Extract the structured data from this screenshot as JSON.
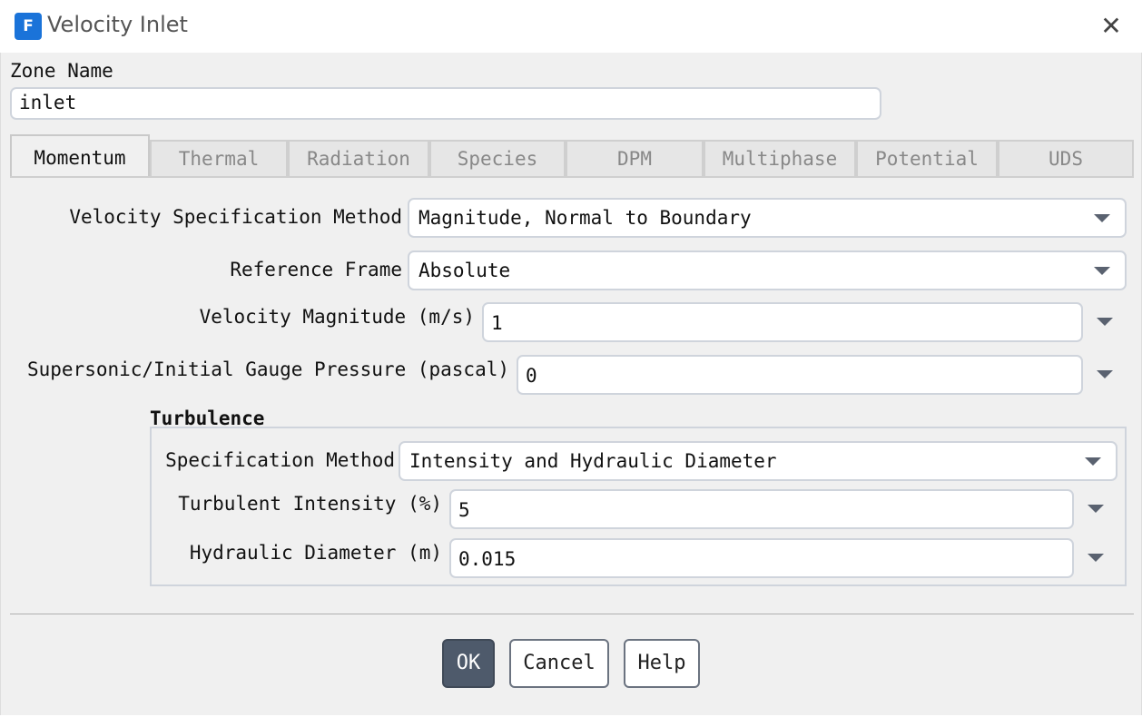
{
  "window": {
    "title": "Velocity Inlet",
    "app_icon_letter": "F",
    "close_glyph": "✕"
  },
  "zone": {
    "label": "Zone Name",
    "value": "inlet"
  },
  "tabs": [
    {
      "label": "Momentum",
      "active": true
    },
    {
      "label": "Thermal",
      "active": false
    },
    {
      "label": "Radiation",
      "active": false
    },
    {
      "label": "Species",
      "active": false
    },
    {
      "label": "DPM",
      "active": false
    },
    {
      "label": "Multiphase",
      "active": false
    },
    {
      "label": "Potential",
      "active": false
    },
    {
      "label": "UDS",
      "active": false
    }
  ],
  "momentum": {
    "velocity_spec": {
      "label": "Velocity Specification Method",
      "value": "Magnitude, Normal to Boundary"
    },
    "reference_frame": {
      "label": "Reference Frame",
      "value": "Absolute"
    },
    "velocity_magnitude": {
      "label": "Velocity Magnitude (m/s)",
      "value": "1"
    },
    "gauge_pressure": {
      "label": "Supersonic/Initial Gauge Pressure (pascal)",
      "value": "0"
    }
  },
  "turbulence": {
    "title": "Turbulence",
    "spec_method": {
      "label": "Specification Method",
      "value": "Intensity and Hydraulic Diameter"
    },
    "intensity": {
      "label": "Turbulent Intensity (%)",
      "value": "5"
    },
    "diameter": {
      "label": "Hydraulic Diameter (m)",
      "value": "0.015"
    }
  },
  "buttons": {
    "ok": "OK",
    "cancel": "Cancel",
    "help": "Help"
  },
  "colors": {
    "accent": "#1a73d9",
    "ok_button": "#4e5a6b"
  }
}
